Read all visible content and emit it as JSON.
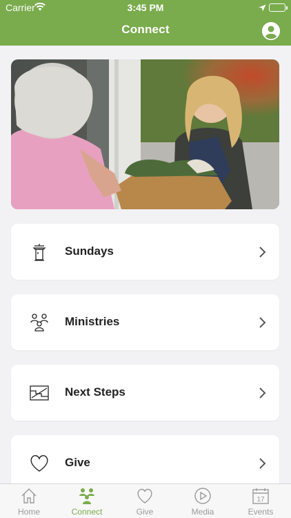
{
  "status": {
    "carrier": "Carrier",
    "time": "3:45 PM"
  },
  "nav": {
    "title": "Connect"
  },
  "hero": {
    "alt": ""
  },
  "cards": [
    {
      "label": "Sundays"
    },
    {
      "label": "Ministries"
    },
    {
      "label": "Next Steps"
    },
    {
      "label": "Give"
    }
  ],
  "tabs": [
    {
      "label": "Home"
    },
    {
      "label": "Connect"
    },
    {
      "label": "Give"
    },
    {
      "label": "Media"
    },
    {
      "label": "Events"
    }
  ],
  "events_icon_day": "17",
  "colors": {
    "brand": "#7aab4d",
    "tab_inactive": "#9a9a9a"
  }
}
